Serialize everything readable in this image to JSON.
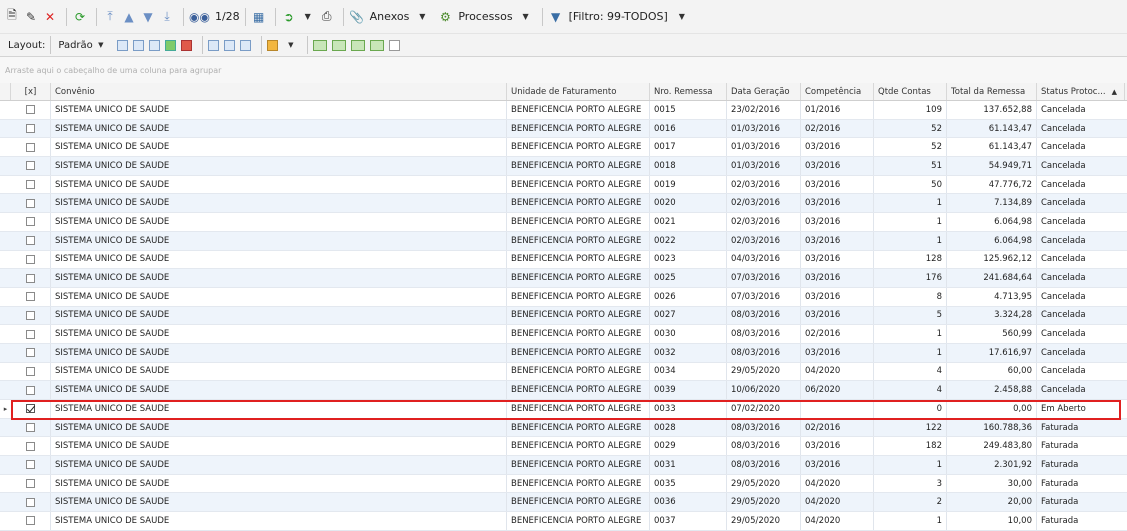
{
  "toolbar": {
    "record_counter": "1/28",
    "anexos_label": "Anexos",
    "processos_label": "Processos",
    "filter_label": "[Filtro: 99-TODOS]"
  },
  "layout_bar": {
    "layout_label": "Layout:",
    "padrao_label": "Padrão"
  },
  "group_hint": "Arraste aqui o cabeçalho de uma coluna para agrupar",
  "columns": {
    "check": "[x]",
    "convenio": "Convênio",
    "unidade": "Unidade de Faturamento",
    "remessa": "Nro. Remessa",
    "data": "Data Geração",
    "competencia": "Competência",
    "qtde": "Qtde Contas",
    "total": "Total da Remessa",
    "status": "Status Protoc..."
  },
  "rows": [
    {
      "convenio": "SISTEMA UNICO DE SAUDE",
      "unidade": "BENEFICENCIA PORTO ALEGRE",
      "remessa": "0015",
      "data": "23/02/2016",
      "competencia": "01/2016",
      "qtde": "109",
      "total": "137.652,88",
      "status": "Cancelada"
    },
    {
      "convenio": "SISTEMA UNICO DE SAUDE",
      "unidade": "BENEFICENCIA PORTO ALEGRE",
      "remessa": "0016",
      "data": "01/03/2016",
      "competencia": "02/2016",
      "qtde": "52",
      "total": "61.143,47",
      "status": "Cancelada"
    },
    {
      "convenio": "SISTEMA UNICO DE SAUDE",
      "unidade": "BENEFICENCIA PORTO ALEGRE",
      "remessa": "0017",
      "data": "01/03/2016",
      "competencia": "03/2016",
      "qtde": "52",
      "total": "61.143,47",
      "status": "Cancelada"
    },
    {
      "convenio": "SISTEMA UNICO DE SAUDE",
      "unidade": "BENEFICENCIA PORTO ALEGRE",
      "remessa": "0018",
      "data": "01/03/2016",
      "competencia": "03/2016",
      "qtde": "51",
      "total": "54.949,71",
      "status": "Cancelada"
    },
    {
      "convenio": "SISTEMA UNICO DE SAUDE",
      "unidade": "BENEFICENCIA PORTO ALEGRE",
      "remessa": "0019",
      "data": "02/03/2016",
      "competencia": "03/2016",
      "qtde": "50",
      "total": "47.776,72",
      "status": "Cancelada"
    },
    {
      "convenio": "SISTEMA UNICO DE SAUDE",
      "unidade": "BENEFICENCIA PORTO ALEGRE",
      "remessa": "0020",
      "data": "02/03/2016",
      "competencia": "03/2016",
      "qtde": "1",
      "total": "7.134,89",
      "status": "Cancelada"
    },
    {
      "convenio": "SISTEMA UNICO DE SAUDE",
      "unidade": "BENEFICENCIA PORTO ALEGRE",
      "remessa": "0021",
      "data": "02/03/2016",
      "competencia": "03/2016",
      "qtde": "1",
      "total": "6.064,98",
      "status": "Cancelada"
    },
    {
      "convenio": "SISTEMA UNICO DE SAUDE",
      "unidade": "BENEFICENCIA PORTO ALEGRE",
      "remessa": "0022",
      "data": "02/03/2016",
      "competencia": "03/2016",
      "qtde": "1",
      "total": "6.064,98",
      "status": "Cancelada"
    },
    {
      "convenio": "SISTEMA UNICO DE SAUDE",
      "unidade": "BENEFICENCIA PORTO ALEGRE",
      "remessa": "0023",
      "data": "04/03/2016",
      "competencia": "03/2016",
      "qtde": "128",
      "total": "125.962,12",
      "status": "Cancelada"
    },
    {
      "convenio": "SISTEMA UNICO DE SAUDE",
      "unidade": "BENEFICENCIA PORTO ALEGRE",
      "remessa": "0025",
      "data": "07/03/2016",
      "competencia": "03/2016",
      "qtde": "176",
      "total": "241.684,64",
      "status": "Cancelada"
    },
    {
      "convenio": "SISTEMA UNICO DE SAUDE",
      "unidade": "BENEFICENCIA PORTO ALEGRE",
      "remessa": "0026",
      "data": "07/03/2016",
      "competencia": "03/2016",
      "qtde": "8",
      "total": "4.713,95",
      "status": "Cancelada"
    },
    {
      "convenio": "SISTEMA UNICO DE SAUDE",
      "unidade": "BENEFICENCIA PORTO ALEGRE",
      "remessa": "0027",
      "data": "08/03/2016",
      "competencia": "03/2016",
      "qtde": "5",
      "total": "3.324,28",
      "status": "Cancelada"
    },
    {
      "convenio": "SISTEMA UNICO DE SAUDE",
      "unidade": "BENEFICENCIA PORTO ALEGRE",
      "remessa": "0030",
      "data": "08/03/2016",
      "competencia": "02/2016",
      "qtde": "1",
      "total": "560,99",
      "status": "Cancelada"
    },
    {
      "convenio": "SISTEMA UNICO DE SAUDE",
      "unidade": "BENEFICENCIA PORTO ALEGRE",
      "remessa": "0032",
      "data": "08/03/2016",
      "competencia": "03/2016",
      "qtde": "1",
      "total": "17.616,97",
      "status": "Cancelada"
    },
    {
      "convenio": "SISTEMA UNICO DE SAUDE",
      "unidade": "BENEFICENCIA PORTO ALEGRE",
      "remessa": "0034",
      "data": "29/05/2020",
      "competencia": "04/2020",
      "qtde": "4",
      "total": "60,00",
      "status": "Cancelada"
    },
    {
      "convenio": "SISTEMA UNICO DE SAUDE",
      "unidade": "BENEFICENCIA PORTO ALEGRE",
      "remessa": "0039",
      "data": "10/06/2020",
      "competencia": "06/2020",
      "qtde": "4",
      "total": "2.458,88",
      "status": "Cancelada"
    },
    {
      "convenio": "SISTEMA UNICO DE SAUDE",
      "unidade": "BENEFICENCIA PORTO ALEGRE",
      "remessa": "0033",
      "data": "07/02/2020",
      "competencia": "",
      "qtde": "0",
      "total": "0,00",
      "status": "Em Aberto",
      "checked": true,
      "current": true
    },
    {
      "convenio": "SISTEMA UNICO DE SAUDE",
      "unidade": "BENEFICENCIA PORTO ALEGRE",
      "remessa": "0028",
      "data": "08/03/2016",
      "competencia": "02/2016",
      "qtde": "122",
      "total": "160.788,36",
      "status": "Faturada"
    },
    {
      "convenio": "SISTEMA UNICO DE SAUDE",
      "unidade": "BENEFICENCIA PORTO ALEGRE",
      "remessa": "0029",
      "data": "08/03/2016",
      "competencia": "03/2016",
      "qtde": "182",
      "total": "249.483,80",
      "status": "Faturada"
    },
    {
      "convenio": "SISTEMA UNICO DE SAUDE",
      "unidade": "BENEFICENCIA PORTO ALEGRE",
      "remessa": "0031",
      "data": "08/03/2016",
      "competencia": "03/2016",
      "qtde": "1",
      "total": "2.301,92",
      "status": "Faturada"
    },
    {
      "convenio": "SISTEMA UNICO DE SAUDE",
      "unidade": "BENEFICENCIA PORTO ALEGRE",
      "remessa": "0035",
      "data": "29/05/2020",
      "competencia": "04/2020",
      "qtde": "3",
      "total": "30,00",
      "status": "Faturada"
    },
    {
      "convenio": "SISTEMA UNICO DE SAUDE",
      "unidade": "BENEFICENCIA PORTO ALEGRE",
      "remessa": "0036",
      "data": "29/05/2020",
      "competencia": "04/2020",
      "qtde": "2",
      "total": "20,00",
      "status": "Faturada"
    },
    {
      "convenio": "SISTEMA UNICO DE SAUDE",
      "unidade": "BENEFICENCIA PORTO ALEGRE",
      "remessa": "0037",
      "data": "29/05/2020",
      "competencia": "04/2020",
      "qtde": "1",
      "total": "10,00",
      "status": "Faturada"
    }
  ]
}
